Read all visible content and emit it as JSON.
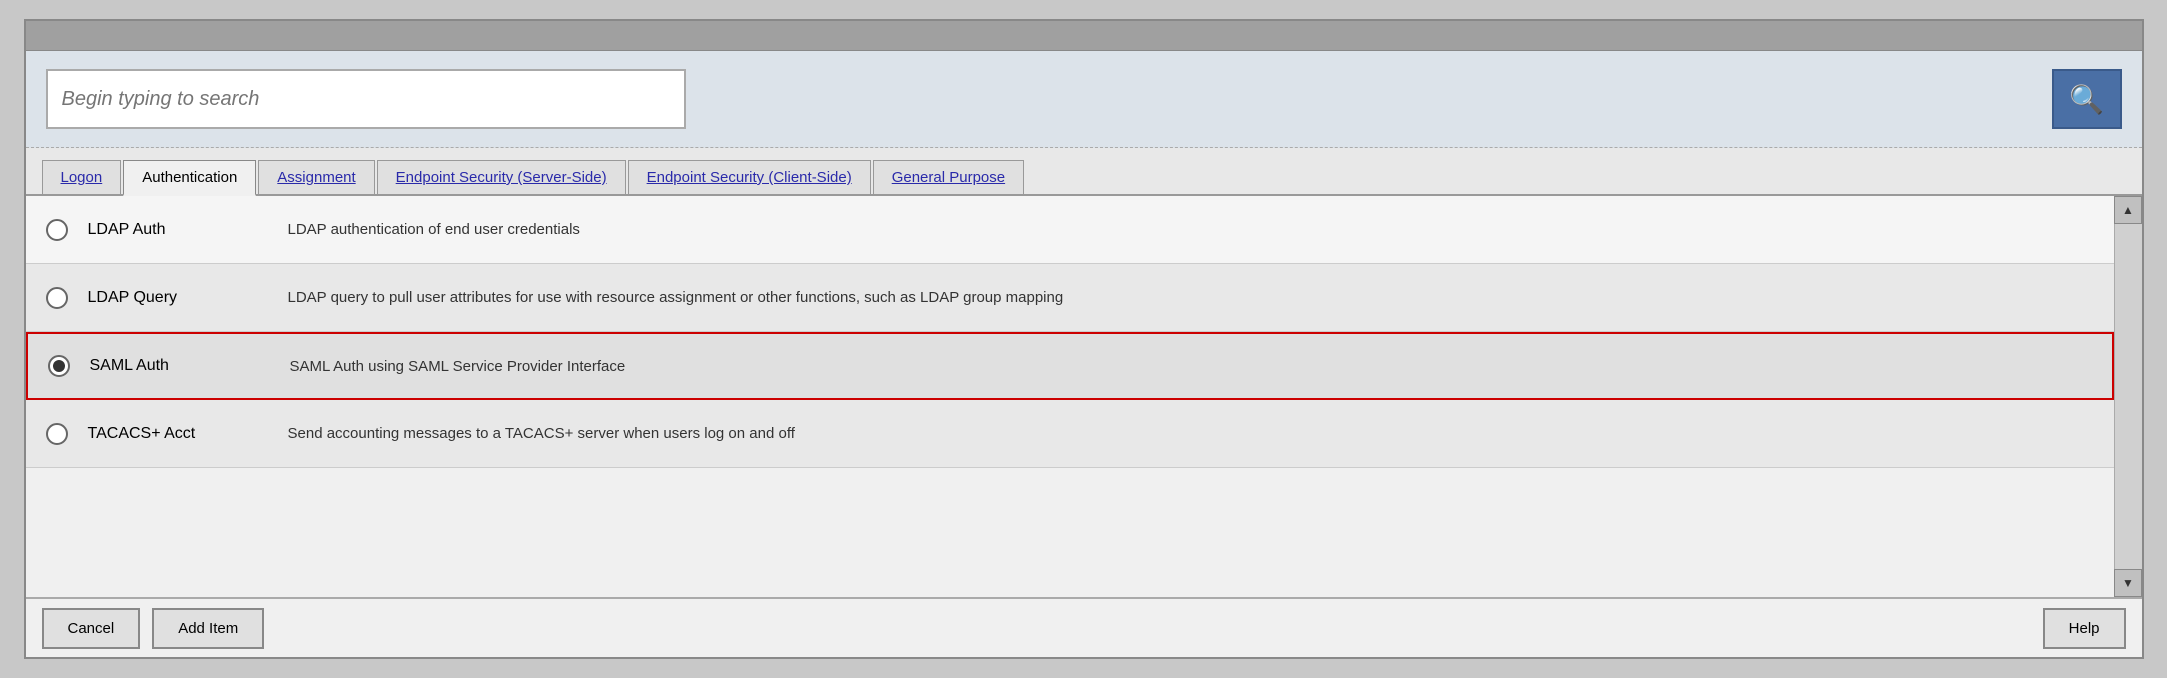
{
  "search": {
    "placeholder": "Begin typing to search"
  },
  "tabs": [
    {
      "id": "logon",
      "label": "Logon",
      "active": false
    },
    {
      "id": "authentication",
      "label": "Authentication",
      "active": true
    },
    {
      "id": "assignment",
      "label": "Assignment",
      "active": false
    },
    {
      "id": "endpoint-server",
      "label": "Endpoint Security (Server-Side)",
      "active": false
    },
    {
      "id": "endpoint-client",
      "label": "Endpoint Security (Client-Side)",
      "active": false
    },
    {
      "id": "general-purpose",
      "label": "General Purpose",
      "active": false
    }
  ],
  "items": [
    {
      "id": "ldap-auth",
      "name": "LDAP Auth",
      "description": "LDAP authentication of end user credentials",
      "selected": false
    },
    {
      "id": "ldap-query",
      "name": "LDAP Query",
      "description": "LDAP query to pull user attributes for use with resource assignment or other functions, such as LDAP group mapping",
      "selected": false
    },
    {
      "id": "saml-auth",
      "name": "SAML Auth",
      "description": "SAML Auth using SAML Service Provider Interface",
      "selected": true
    },
    {
      "id": "tacacs-acct",
      "name": "TACACS+ Acct",
      "description": "Send accounting messages to a TACACS+ server when users log on and off",
      "selected": false
    }
  ],
  "footer": {
    "cancel_label": "Cancel",
    "add_item_label": "Add Item",
    "help_label": "Help"
  },
  "search_icon": "🔍"
}
